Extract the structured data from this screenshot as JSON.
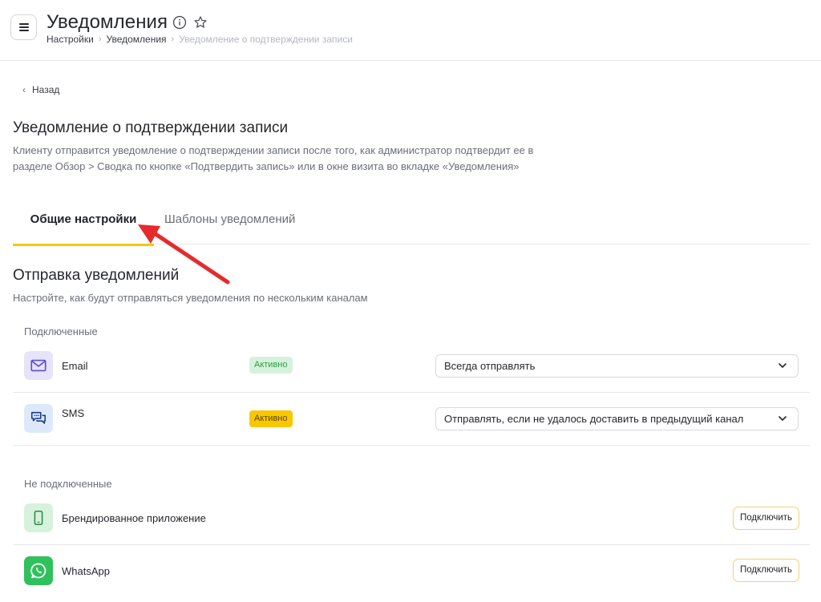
{
  "header": {
    "title": "Уведомления",
    "breadcrumb": [
      "Настройки",
      "Уведомления",
      "Уведомление о подтверждении записи"
    ]
  },
  "back_label": "Назад",
  "section": {
    "title": "Уведомление о подтверждении записи",
    "description": "Клиенту отправится уведомление о подтверждении записи после того, как администратор подтвердит ее в разделе Обзор > Сводка по кнопке «Подтвердить запись» или в окне визита во вкладке «Уведомления»"
  },
  "tabs": [
    {
      "label": "Общие настройки",
      "active": true
    },
    {
      "label": "Шаблоны уведомлений",
      "active": false
    }
  ],
  "sending": {
    "title": "Отправка уведомлений",
    "description": "Настройте, как будут отправляться уведомления по нескольким каналам"
  },
  "connected": {
    "label": "Подключенные",
    "channels": [
      {
        "name": "Email",
        "icon": "envelope-icon",
        "status": "Активно",
        "status_color": "#d7f2dc",
        "mode": "Всегда отправлять"
      },
      {
        "name": "SMS",
        "icon": "chat-bubbles-icon",
        "status": "Активно",
        "status_color": "#f8c700",
        "mode": "Отправлять, если не удалось доставить в предыдущий канал"
      }
    ]
  },
  "not_connected": {
    "label": "Не подключенные",
    "channels": [
      {
        "name": "Брендированное приложение",
        "icon": "phone-icon",
        "action": "Подключить"
      },
      {
        "name": "WhatsApp",
        "icon": "whatsapp-icon",
        "action": "Подключить"
      }
    ]
  },
  "colors": {
    "accent": "#f5c800",
    "annotation_arrow": "#e52b2b"
  }
}
